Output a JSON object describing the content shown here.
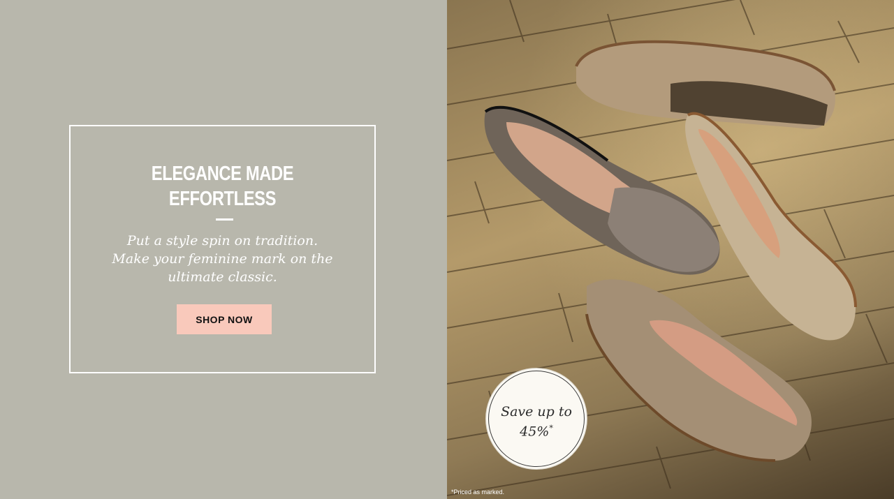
{
  "promo": {
    "headline_line1": "ELEGANCE MADE",
    "headline_line2": "EFFORTLESS",
    "subtext_line1": "Put a style spin on tradition.",
    "subtext_line2": "Make your feminine mark on the",
    "subtext_line3": "ultimate classic.",
    "cta_label": "SHOP NOW"
  },
  "badge": {
    "line1": "Save up to",
    "line2": "45%",
    "marker": "*"
  },
  "footnote": "*Priced as marked.",
  "colors": {
    "left_background": "#b8b7ac",
    "cta_background": "#f9c9bb",
    "box_border": "#ffffff"
  }
}
